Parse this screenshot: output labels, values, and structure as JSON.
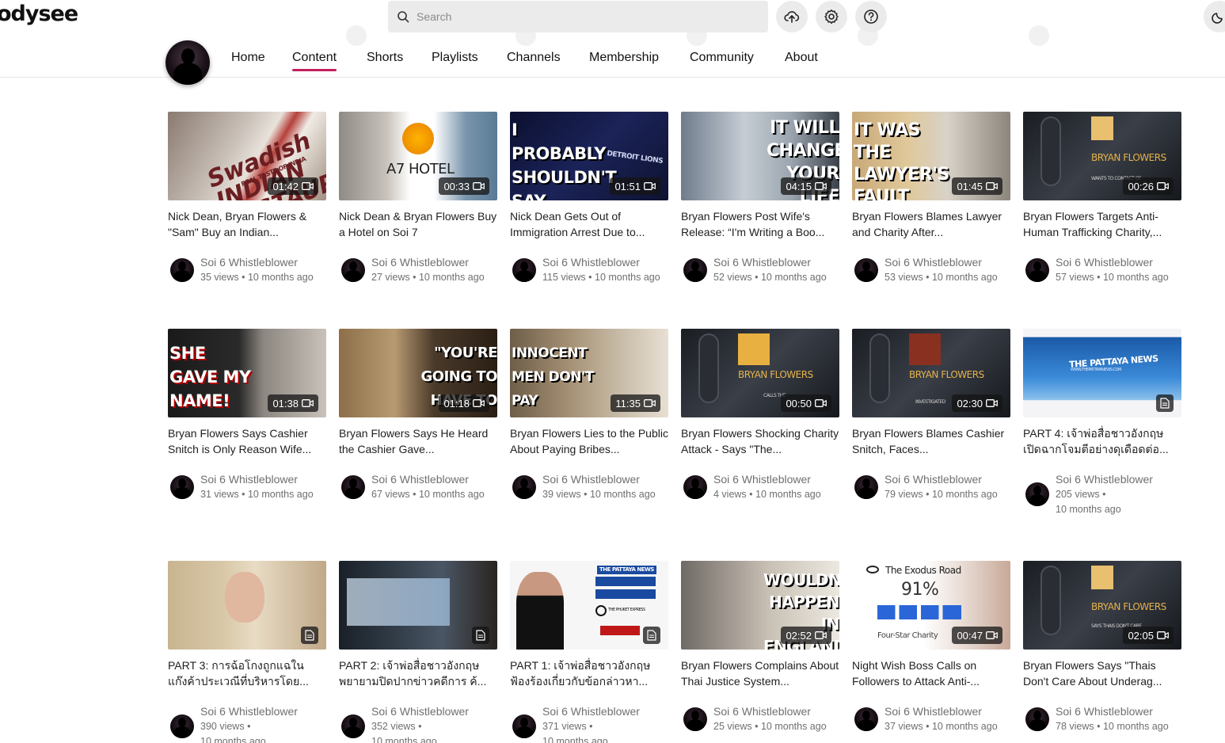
{
  "header": {
    "logo_text": "odysee",
    "search_placeholder": "Search",
    "upload_icon": "cloud-upload-icon",
    "settings_icon": "gear-icon",
    "help_icon": "help-icon",
    "theme_icon": "moon-icon"
  },
  "nav": {
    "tabs": [
      {
        "label": "Home",
        "active": false
      },
      {
        "label": "Content",
        "active": true
      },
      {
        "label": "Shorts",
        "active": false
      },
      {
        "label": "Playlists",
        "active": false
      },
      {
        "label": "Channels",
        "active": false
      },
      {
        "label": "Membership",
        "active": false
      },
      {
        "label": "Community",
        "active": false
      },
      {
        "label": "About",
        "active": false
      }
    ],
    "accent_color": "#c41f5f"
  },
  "videos": [
    {
      "title": "Nick Dean, Bryan Flowers & \"Sam\" Buy an Indian...",
      "channel": "Soi 6 Whistleblower",
      "views": "35 views",
      "age": "10 months ago",
      "duration": "01:42",
      "type": "video",
      "thumb_text": "Swadish INDIAN RESTAURANT",
      "thumb_sub": "REAL TASTE OF INDIA"
    },
    {
      "title": "Nick Dean & Bryan Flowers Buy a Hotel on Soi 7",
      "channel": "Soi 6 Whistleblower",
      "views": "27 views",
      "age": "10 months ago",
      "duration": "00:33",
      "type": "video",
      "thumb_text": "A7 HOTEL",
      "thumb_sub": ""
    },
    {
      "title": "Nick Dean Gets Out of Immigration Arrest Due to...",
      "channel": "Soi 6 Whistleblower",
      "views": "115 views",
      "age": "10 months ago",
      "duration": "01:51",
      "type": "video",
      "thumb_text": "I PROBABLY SHOULDN'T SAY THIS",
      "thumb_sub": "DETROIT LIONS"
    },
    {
      "title": "Bryan Flowers Post Wife's Release: “I'm Writing a Boo...",
      "channel": "Soi 6 Whistleblower",
      "views": "52 views",
      "age": "10 months ago",
      "duration": "04:15",
      "type": "video",
      "thumb_text": "IT WILL CHANGE YOUR LIFE",
      "thumb_sub": ""
    },
    {
      "title": "Bryan Flowers Blames Lawyer and Charity After...",
      "channel": "Soi 6 Whistleblower",
      "views": "53 views",
      "age": "10 months ago",
      "duration": "01:45",
      "type": "video",
      "thumb_text": "IT WAS THE LAWYER'S FAULT",
      "thumb_sub": ""
    },
    {
      "title": "Bryan Flowers Targets Anti-Human Trafficking Charity,...",
      "channel": "Soi 6 Whistleblower",
      "views": "57 views",
      "age": "10 months ago",
      "duration": "00:26",
      "type": "video",
      "thumb_text": "BRYAN FLOWERS",
      "thumb_sub": "WANTS TO CONTACT OF"
    },
    {
      "title": "Bryan Flowers Says Cashier Snitch is Only Reason Wife...",
      "channel": "Soi 6 Whistleblower",
      "views": "31 views",
      "age": "10 months ago",
      "duration": "01:38",
      "type": "video",
      "thumb_text": "SHE GAVE MY NAME!",
      "thumb_sub": ""
    },
    {
      "title": "Bryan Flowers Says He Heard the Cashier Gave...",
      "channel": "Soi 6 Whistleblower",
      "views": "67 views",
      "age": "10 months ago",
      "duration": "01:18",
      "type": "video",
      "thumb_text": "\"YOU'RE GOING TO HAVE TO PAY!\"",
      "thumb_sub": ""
    },
    {
      "title": "Bryan Flowers Lies to the Public About Paying Bribes...",
      "channel": "Soi 6 Whistleblower",
      "views": "39 views",
      "age": "10 months ago",
      "duration": "11:35",
      "type": "video",
      "thumb_text": "INNOCENT MEN DON'T PAY ANYTHING",
      "thumb_sub": ""
    },
    {
      "title": "Bryan Flowers Shocking Charity Attack - Says \"The...",
      "channel": "Soi 6 Whistleblower",
      "views": "4 views",
      "age": "10 months ago",
      "duration": "00:50",
      "type": "video",
      "thumb_text": "BRYAN FLOWERS",
      "thumb_sub": "CALLS THE"
    },
    {
      "title": "Bryan Flowers Blames Cashier Snitch, Faces...",
      "channel": "Soi 6 Whistleblower",
      "views": "79 views",
      "age": "10 months ago",
      "duration": "02:30",
      "type": "video",
      "thumb_text": "BRYAN FLOWERS",
      "thumb_sub": "INVESTIGATED"
    },
    {
      "title": "PART 4: เจ้าพ่อสื่อชาวอังกฤษ เปิดฉากโจมตีอย่างดุเดือดต่อ...",
      "channel": "Soi 6 Whistleblower",
      "views": "205 views",
      "age": "10 months ago",
      "duration": "",
      "type": "post",
      "thumb_text": "THE PATTAYA NEWS",
      "thumb_sub": "WWW.THEPATTAYANEWS.COM"
    },
    {
      "title": "PART 3: การฉ้อโกงถูกแฉใน แก๊งค้าประเวณีที่บริหารโดย...",
      "channel": "Soi 6 Whistleblower",
      "views": "390 views",
      "age": "10 months ago",
      "duration": "",
      "type": "post",
      "thumb_text": "",
      "thumb_sub": ""
    },
    {
      "title": "PART 2: เจ้าพ่อสื่อชาวอังกฤษ พยายามปิดปากข่าวคดีการ ค้...",
      "channel": "Soi 6 Whistleblower",
      "views": "352 views",
      "age": "10 months ago",
      "duration": "",
      "type": "post",
      "thumb_text": "",
      "thumb_sub": ""
    },
    {
      "title": "PART 1: เจ้าพ่อสื่อชาวอังกฤษ ฟ้องร้องเกี่ยวกับข้อกล่าวหา...",
      "channel": "Soi 6 Whistleblower",
      "views": "371 views",
      "age": "10 months ago",
      "duration": "",
      "type": "post",
      "thumb_text": "THE PATTAYA NEWS",
      "thumb_sub": "THE PHUKET EXPRESS"
    },
    {
      "title": "Bryan Flowers Complains About Thai Justice System...",
      "channel": "Soi 6 Whistleblower",
      "views": "25 views",
      "age": "10 months ago",
      "duration": "02:52",
      "type": "video",
      "thumb_text": "WOULDN'T HAPPEN IN ENGLAND",
      "thumb_sub": ""
    },
    {
      "title": "Night Wish Boss Calls on Followers to Attack Anti-...",
      "channel": "Soi 6 Whistleblower",
      "views": "37 views",
      "age": "10 months ago",
      "duration": "00:47",
      "type": "video",
      "thumb_text": "The Exodus Road",
      "thumb_sub": "Four-Star Charity",
      "thumb_score": "91%"
    },
    {
      "title": "Bryan Flowers Says \"Thais Don't Care About Underag...",
      "channel": "Soi 6 Whistleblower",
      "views": "78 views",
      "age": "10 months ago",
      "duration": "02:05",
      "type": "video",
      "thumb_text": "BRYAN FLOWERS",
      "thumb_sub": "SAYS THAIS DON'T CARE"
    }
  ]
}
